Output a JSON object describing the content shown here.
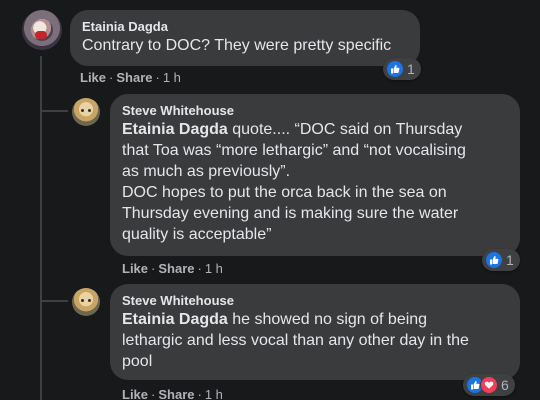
{
  "comments": [
    {
      "author": "Etainia Dagda",
      "text": "Contrary to DOC? They were pretty specific",
      "actions": {
        "like": "Like",
        "share": "Share",
        "time": "1 h"
      },
      "reactions": {
        "types": [
          "like"
        ],
        "count": "1"
      }
    },
    {
      "author": "Steve Whitehouse",
      "mention": "Etainia Dagda",
      "text_lines": [
        " quote.... “DOC said on Thursday",
        "that Toa was “more lethargic” and “not vocalising",
        "as much as previously”.",
        "DOC hopes to put the orca back in the sea on",
        "Thursday evening and is making sure the water",
        "quality is acceptable”"
      ],
      "actions": {
        "like": "Like",
        "share": "Share",
        "time": "1 h"
      },
      "reactions": {
        "types": [
          "like"
        ],
        "count": "1"
      }
    },
    {
      "author": "Steve Whitehouse",
      "mention": "Etainia Dagda",
      "text_lines": [
        " he showed no sign of being",
        "lethargic and less vocal than any other day in the",
        "pool"
      ],
      "actions": {
        "like": "Like",
        "share": "Share",
        "time": "1 h"
      },
      "reactions": {
        "types": [
          "like",
          "love"
        ],
        "count": "6"
      }
    }
  ],
  "separator": "·",
  "colors": {
    "background": "#18191a",
    "bubble": "#3a3b3c",
    "text": "#e4e6eb",
    "meta": "#b0b3b8",
    "like": "#1b74e4",
    "love": "#f33e58"
  },
  "icons": {
    "like": "thumbs-up-icon",
    "love": "heart-icon"
  }
}
